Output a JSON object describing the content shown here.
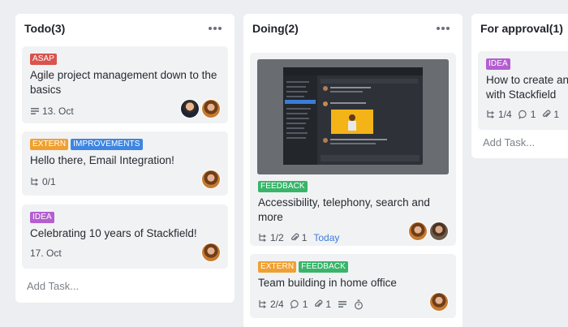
{
  "columns": [
    {
      "title": "Todo",
      "count": "(3)",
      "add_task": "Add Task...",
      "cards": [
        {
          "tags": [
            {
              "label": "ASAP",
              "color": "#d9534f"
            }
          ],
          "title": "Agile project management down to the basics",
          "date": "13. Oct"
        },
        {
          "tags": [
            {
              "label": "EXTERN",
              "color": "#f0a030"
            },
            {
              "label": "IMPROVEMENTS",
              "color": "#3e86e0"
            }
          ],
          "title": "Hello there, Email Integration!",
          "subtasks": "0/1"
        },
        {
          "tags": [
            {
              "label": "IDEA",
              "color": "#b35fd1"
            }
          ],
          "title": "Celebrating 10 years of Stackfield!",
          "date": "17. Oct"
        }
      ]
    },
    {
      "title": "Doing",
      "count": "(2)",
      "cards": [
        {
          "tags": [
            {
              "label": "FEEDBACK",
              "color": "#38b56a"
            }
          ],
          "title": "Accessibility, telephony, search and more",
          "subtasks": "1/2",
          "attachments": "1",
          "due": "Today"
        },
        {
          "tags": [
            {
              "label": "EXTERN",
              "color": "#f0a030"
            },
            {
              "label": "FEEDBACK",
              "color": "#38b56a"
            }
          ],
          "title": "Team building in home office",
          "subtasks": "2/4",
          "comments": "1",
          "attachments": "1"
        }
      ]
    },
    {
      "title": "For approval",
      "count": "(1)",
      "add_task": "Add Task...",
      "cards": [
        {
          "tags": [
            {
              "label": "IDEA",
              "color": "#b35fd1"
            }
          ],
          "title": "How to create an knowledge base with Stackfield",
          "subtasks": "1/4",
          "comments": "1",
          "attachments": "1"
        }
      ]
    }
  ],
  "icons": {
    "more": "more-horizontal-icon",
    "subtask": "subtask-icon",
    "comment": "comment-icon",
    "attachment": "paperclip-icon",
    "description": "description-lines-icon",
    "timer": "stopwatch-icon"
  },
  "colors": {
    "background": "#eceef1",
    "column": "#ffffff",
    "card": "#f1f2f4",
    "link": "#3d7dd8"
  }
}
